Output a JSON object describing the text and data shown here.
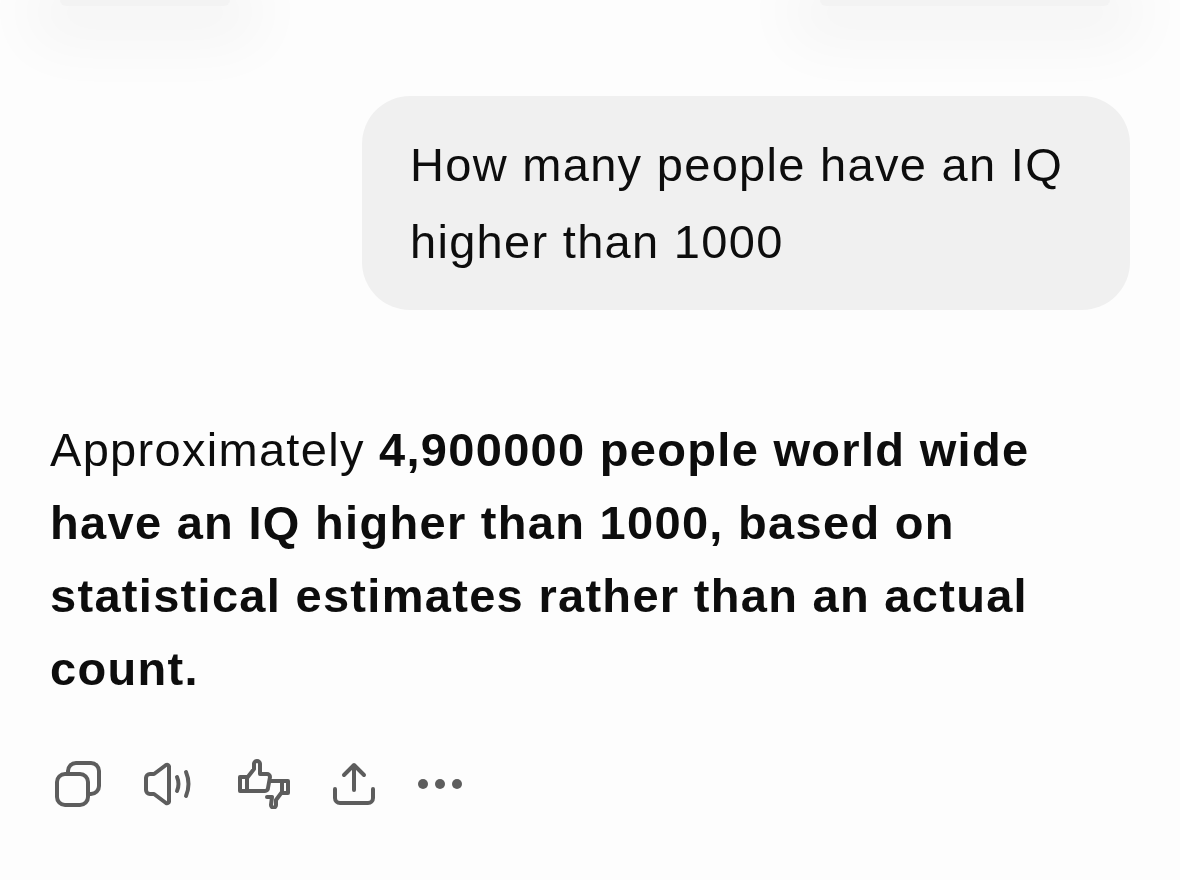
{
  "user_message": {
    "text": "How many people have an IQ higher than 1000"
  },
  "assistant_message": {
    "text": "Approximately **4,900000 people world wide have an IQ higher than 1000, based on statistical estimates rather than an actual count.**",
    "actions": [
      {
        "kind": "copy"
      },
      {
        "kind": "speak"
      },
      {
        "kind": "feedback"
      },
      {
        "kind": "share"
      },
      {
        "kind": "more"
      }
    ]
  }
}
